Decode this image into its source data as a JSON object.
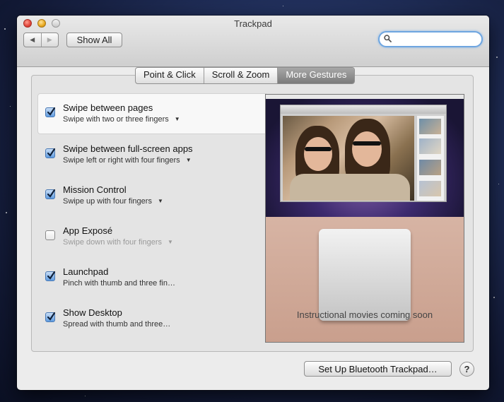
{
  "window": {
    "title": "Trackpad"
  },
  "toolbar": {
    "back_icon": "◀",
    "forward_icon": "▶",
    "show_all_label": "Show All"
  },
  "search": {
    "value": "",
    "placeholder": ""
  },
  "tabs": [
    {
      "label": "Point & Click",
      "active": false
    },
    {
      "label": "Scroll & Zoom",
      "active": false
    },
    {
      "label": "More Gestures",
      "active": true
    }
  ],
  "gestures": [
    {
      "title": "Swipe between pages",
      "description": "Swipe with two or three fingers",
      "checked": true,
      "has_menu": true,
      "enabled": true,
      "selected": true
    },
    {
      "title": "Swipe between full-screen apps",
      "description": "Swipe left or right with four fingers",
      "checked": true,
      "has_menu": true,
      "enabled": true
    },
    {
      "title": "Mission Control",
      "description": "Swipe up with four fingers",
      "checked": true,
      "has_menu": true,
      "enabled": true
    },
    {
      "title": "App Exposé",
      "description": "Swipe down with four fingers",
      "checked": false,
      "has_menu": true,
      "enabled": false
    },
    {
      "title": "Launchpad",
      "description": "Pinch with thumb and three fin…",
      "checked": true,
      "has_menu": false,
      "enabled": true
    },
    {
      "title": "Show Desktop",
      "description": "Spread with thumb and three…",
      "checked": true,
      "has_menu": false,
      "enabled": true
    }
  ],
  "preview": {
    "caption": "Instructional movies coming soon"
  },
  "footer": {
    "bluetooth_label": "Set Up Bluetooth Trackpad…",
    "help_label": "?"
  },
  "colors": {
    "accent": "#5f9be0",
    "tab_active": "#8a8a8a",
    "search_focus": "#6fa6e0"
  }
}
